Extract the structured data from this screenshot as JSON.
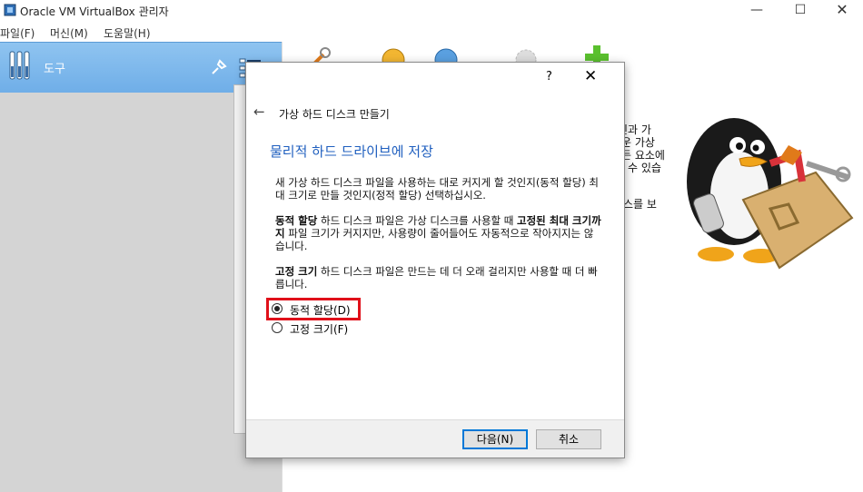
{
  "window": {
    "title": "Oracle VM VirtualBox 관리자",
    "controls": {
      "minimize": "—",
      "maximize": "☐",
      "close": "✕"
    }
  },
  "menu": {
    "items": [
      "파일(F)",
      "머신(M)",
      "도움말(H)"
    ]
  },
  "sidebar": {
    "tools_label": "도구"
  },
  "welcome": {
    "lines": [
      "신과 가",
      "운 가상",
      "든 요소에",
      "수 있습",
      "스를 보"
    ]
  },
  "dialog": {
    "help": "?",
    "close": "✕",
    "back": "←",
    "wizard_title": "가상 하드 디스크 만들기",
    "heading": "물리적 하드 드라이브에 저장",
    "intro": "새 가상 하드 디스크 파일을 사용하는 대로 커지게 할 것인지(동적 할당) 최대 크기로 만들 것인지(정적 할당) 선택하십시오.",
    "dynamic": {
      "bold_term": "동적 할당",
      "text1": " 하드 디스크 파일은 가상 디스크를 사용할 때 ",
      "bold_fixed": "고정된 최대 크기까지",
      "text2": " 파일 크기가 커지지만, 사용량이 줄어들어도 자동적으로 작아지지는 않습니다."
    },
    "fixed": {
      "bold_term": "고정 크기",
      "text": " 하드 디스크 파일은 만드는 데 더 오래 걸리지만 사용할 때 더 빠릅니다."
    },
    "options": [
      {
        "label": "동적 할당(D)",
        "checked": true
      },
      {
        "label": "고정 크기(F)",
        "checked": false
      }
    ],
    "buttons": {
      "next": "다음(N)",
      "cancel": "취소"
    }
  },
  "colors": {
    "accent": "#1f5fbf",
    "highlight": "#e0101a",
    "sidebar_selected": "#7ab8ec"
  }
}
